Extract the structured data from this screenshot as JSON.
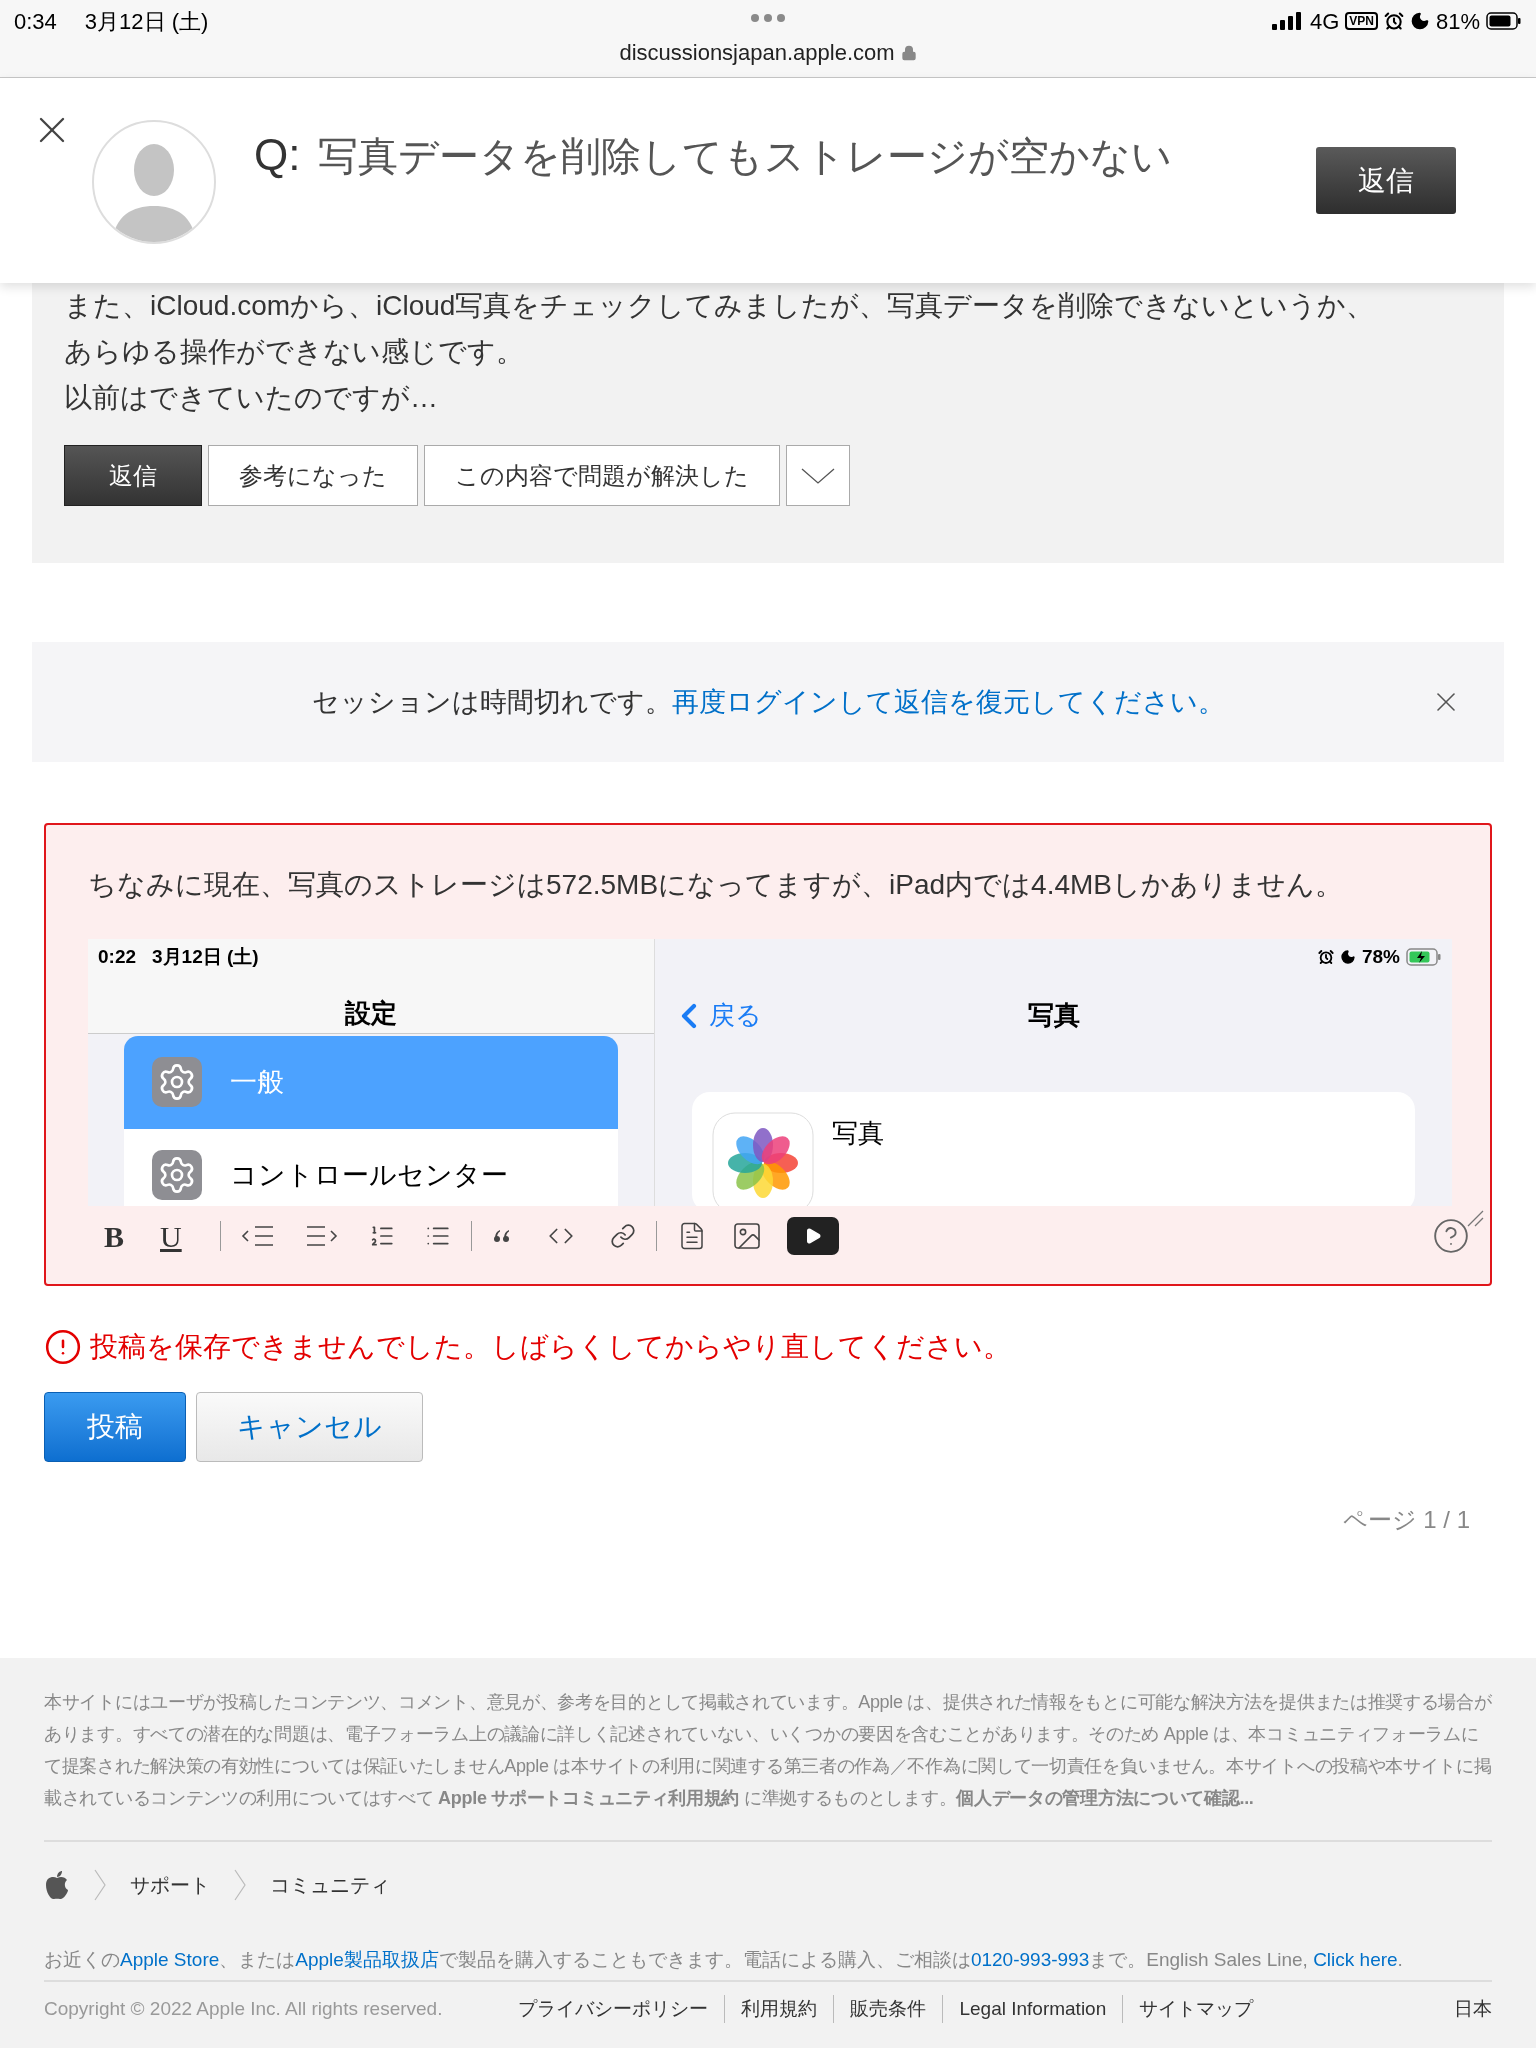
{
  "status_bar": {
    "time": "0:34",
    "date": "3月12日 (土)",
    "network": "4G",
    "vpn": "VPN",
    "battery": "81%"
  },
  "address_bar": {
    "url": "discussionsjapan.apple.com"
  },
  "question_header": {
    "prefix": "Q:",
    "title": "写真データを削除してもストレージが空かない",
    "reply_button": "返信"
  },
  "post": {
    "lines": [
      "また、iCloud.comから、iCloud写真をチェックしてみましたが、写真データを削除できないというか、",
      "あらゆる操作ができない感じです。",
      "以前はできていたのですが…"
    ],
    "actions": [
      {
        "label": "返信",
        "kind": "primary"
      },
      {
        "label": "参考になった",
        "kind": "secondary"
      },
      {
        "label": "この内容で問題が解決した",
        "kind": "secondary"
      }
    ]
  },
  "session_notice": {
    "text": "セッションは時間切れです。",
    "link": "再度ログインして返信を復元してください。"
  },
  "editor": {
    "text": "ちなみに現在、写真のストレージは572.5MBになってますが、iPad内では4.4MBしかありません。",
    "embedded_screenshot": {
      "time": "0:22",
      "date": "3月12日 (土)",
      "battery": "78%",
      "left_title": "設定",
      "items": [
        {
          "label": "一般",
          "selected": true
        },
        {
          "label": "コントロールセンター",
          "selected": false
        }
      ],
      "back": "戻る",
      "right_title": "写真",
      "app_name": "写真"
    },
    "toolbar": [
      {
        "label": "B",
        "kind": "bold"
      },
      {
        "label": "U",
        "kind": "underline"
      }
    ]
  },
  "error": "投稿を保存できませんでした。しばらくしてからやり直してください。",
  "form_buttons": [
    {
      "label": "投稿",
      "kind": "primary"
    },
    {
      "label": "キャンセル",
      "kind": "secondary"
    }
  ],
  "pagination": "ページ 1 / 1",
  "footer": {
    "disclaimer": "本サイトにはユーザが投稿したコンテンツ、コメント、意見が、参考を目的として掲載されています。Apple は、提供された情報をもとに可能な解決方法を提供または推奨する場合があります。すべての潜在的な問題は、電子フォーラム上の議論に詳しく記述されていない、いくつかの要因を含むことがあります。そのため Apple は、本コミュニティフォーラムにて提案された解決策の有効性については保証いたしませんApple は本サイトの利用に関連する第三者の作為／不作為に関して一切責任を負いません。本サイトへの投稿や本サイトに掲載されているコンテンツの利用についてはすべて **Apple サポートコミュニティ利用規約** に準拠するものとします。**個人データの管理方法について確認...**",
    "breadcrumb": [
      "サポート",
      "コミュニティ"
    ],
    "store_info": [
      {
        "kind": "text",
        "text": "お近くの"
      },
      {
        "kind": "link",
        "text": "Apple Store"
      },
      {
        "kind": "text",
        "text": "、または"
      },
      {
        "kind": "link",
        "text": "Apple製品取扱店"
      },
      {
        "kind": "text",
        "text": "で製品を購入することもできます。電話による購入、ご相談は"
      },
      {
        "kind": "link",
        "text": "0120-993-993"
      },
      {
        "kind": "text",
        "text": "まで。English Sales Line, "
      },
      {
        "kind": "link",
        "text": "Click here"
      },
      {
        "kind": "text",
        "text": "."
      }
    ],
    "copyright": "Copyright © 2022 Apple Inc. All rights reserved.",
    "links": [
      "プライバシーポリシー",
      "利用規約",
      "販売条件",
      "Legal Information",
      "サイトマップ"
    ],
    "region": "日本"
  }
}
